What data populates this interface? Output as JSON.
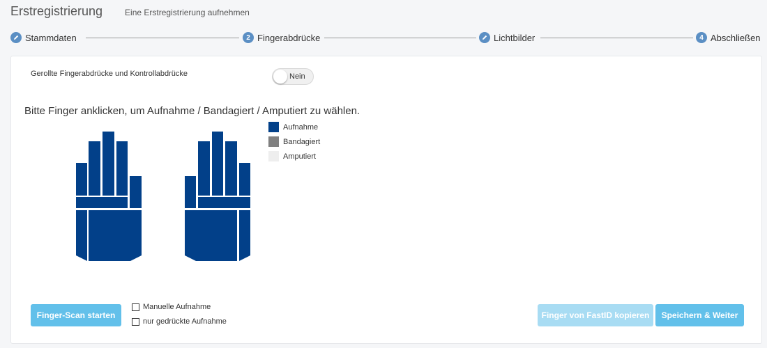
{
  "header": {
    "title": "Erstregistrierung",
    "subtitle": "Eine Erstregistrierung aufnehmen"
  },
  "stepper": {
    "steps": [
      {
        "label": "Stammdaten",
        "marker": "pencil-icon",
        "number": ""
      },
      {
        "label": "Fingerabdrücke",
        "marker": "number",
        "number": "2"
      },
      {
        "label": "Lichtbilder",
        "marker": "pencil-icon",
        "number": ""
      },
      {
        "label": "Abschließen",
        "marker": "number",
        "number": "4"
      }
    ]
  },
  "rolled": {
    "label": "Gerollte Fingerabdrücke und Kontrollabdrücke",
    "toggle_value": "Nein",
    "enabled": false
  },
  "instruction": "Bitte Finger anklicken, um Aufnahme / Bandagiert / Amputiert zu wählen.",
  "legend": [
    {
      "label": "Aufnahme",
      "color": "#024089"
    },
    {
      "label": "Bandagiert",
      "color": "#808080"
    },
    {
      "label": "Amputiert",
      "color": "#eeeeee"
    }
  ],
  "hands": {
    "fill_color": "#024089",
    "state": "Aufnahme"
  },
  "actions": {
    "scan_label": "Finger-Scan starten",
    "manual_label": "Manuelle Aufnahme",
    "manual_checked": false,
    "pressed_label": "nur gedrückte Aufnahme",
    "pressed_checked": false,
    "copy_label": "Finger von FastID kopieren",
    "save_label": "Speichern & Weiter"
  }
}
